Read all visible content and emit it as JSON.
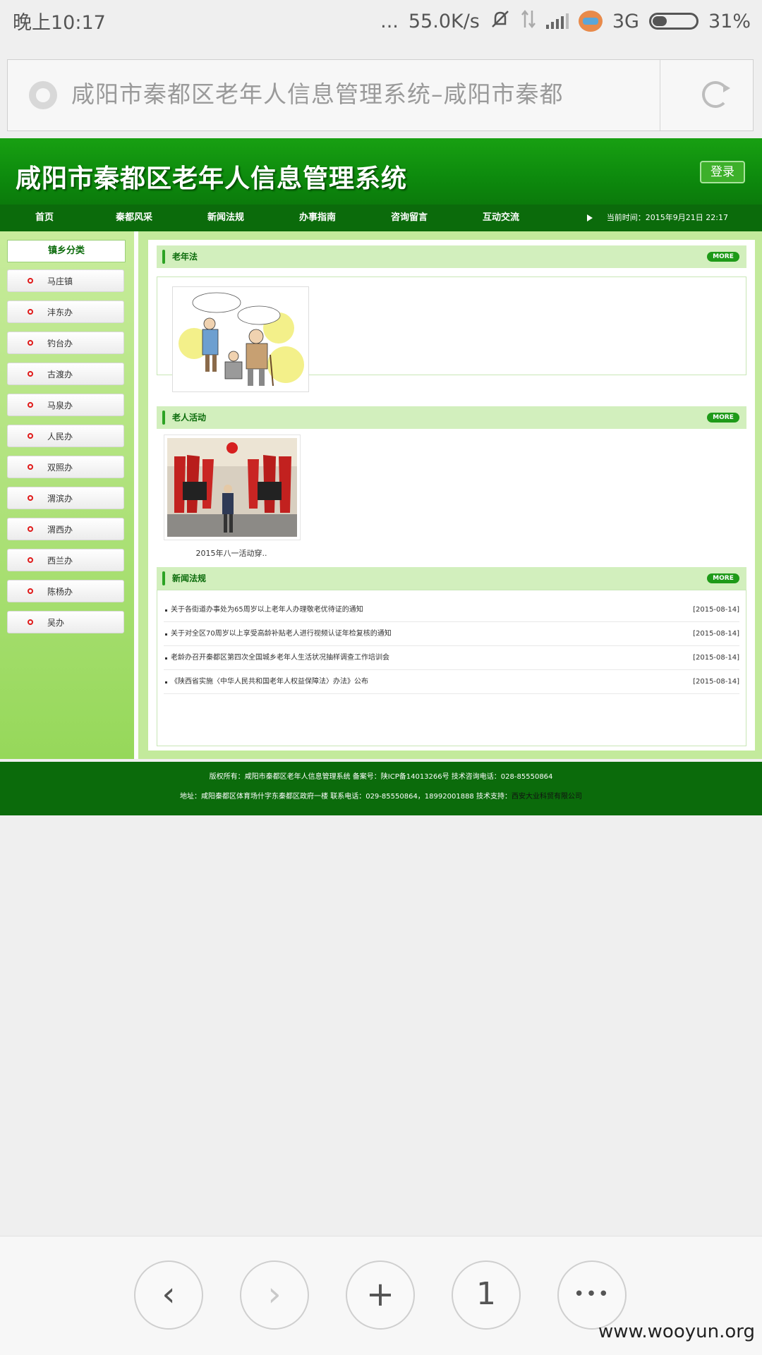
{
  "status_bar": {
    "time": "晚上10:17",
    "dots": "...",
    "network_speed": "55.0K/s",
    "network_type": "3G",
    "battery": "31%"
  },
  "address_bar": {
    "title": "咸阳市秦都区老年人信息管理系统–咸阳市秦都"
  },
  "site": {
    "title": "咸阳市秦都区老年人信息管理系统",
    "login_label": "登录",
    "nav": [
      "首页",
      "秦都风采",
      "新闻法规",
      "办事指南",
      "咨询留言",
      "互动交流"
    ],
    "current_time": "当前时间：2015年9月21日 22:17",
    "sidebar": {
      "header": "镇乡分类",
      "items": [
        "马庄镇",
        "沣东办",
        "钓台办",
        "古渡办",
        "马泉办",
        "人民办",
        "双照办",
        "渭滨办",
        "渭西办",
        "西兰办",
        "陈杨办",
        "吴办"
      ]
    },
    "sections": {
      "elderly_law": {
        "title": "老年法",
        "more": "MORE"
      },
      "elderly_activity": {
        "title": "老人活动",
        "more": "MORE",
        "caption": "2015年八一活动穿.."
      },
      "news": {
        "title": "新闻法规",
        "more": "MORE",
        "items": [
          {
            "title": "关于各街道办事处为65周岁以上老年人办理敬老优待证的通知",
            "date": "[2015-08-14]"
          },
          {
            "title": "关于对全区70周岁以上享受高龄补贴老人进行视频认证年检复核的通知",
            "date": "[2015-08-14]"
          },
          {
            "title": "老龄办召开秦都区第四次全国城乡老年人生活状况抽样调查工作培训会",
            "date": "[2015-08-14]"
          },
          {
            "title": "《陕西省实施〈中华人民共和国老年人权益保障法〉办法》公布",
            "date": "[2015-08-14]"
          }
        ]
      }
    },
    "footer": {
      "line1": "版权所有：咸阳市秦都区老年人信息管理系统 备案号：陕ICP备14013266号 技术咨询电话：028-85550864",
      "line2": "地址：咸阳秦都区体育场什字东秦都区政府一楼 联系电话：029-85550864，18992001888 技术支持：",
      "company": "西安大业科贸有限公司"
    }
  },
  "bottom_bar": {
    "back": "‹",
    "forward": "›",
    "new_tab": "+",
    "tab_count": "1",
    "menu": "•••",
    "watermark": "www.wooyun.org"
  },
  "colors": {
    "header_green": "#0d8a0d",
    "nav_green": "#0b6b0b",
    "panel_light_green": "#c3ea9c",
    "section_head": "#d2efbd"
  }
}
